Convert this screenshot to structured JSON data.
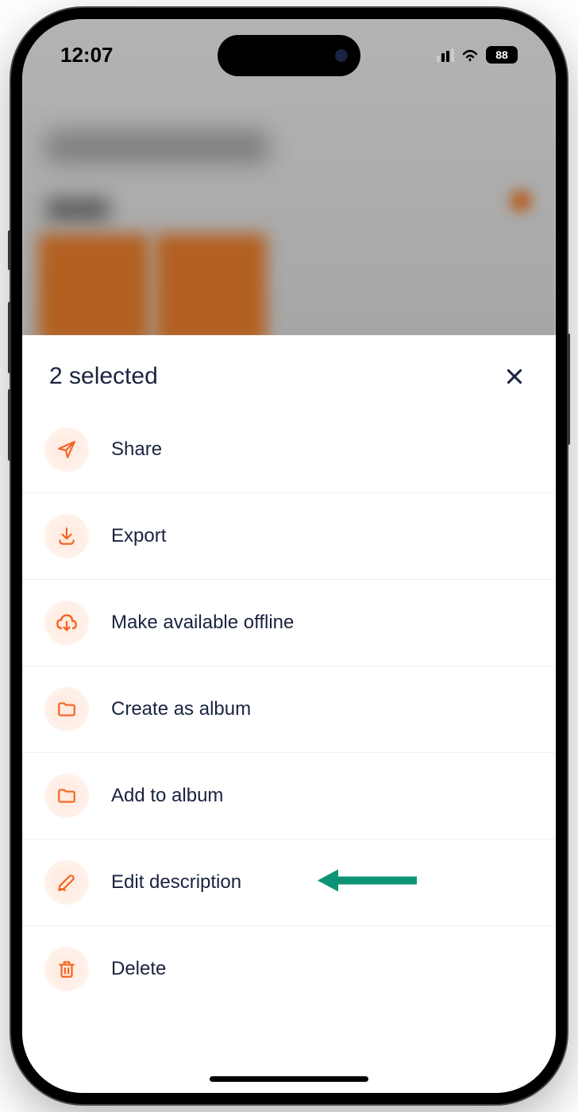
{
  "status": {
    "time": "12:07",
    "battery": "88"
  },
  "sheet": {
    "title": "2 selected"
  },
  "menu": {
    "share": "Share",
    "export": "Export",
    "offline": "Make available offline",
    "create_album": "Create as album",
    "add_album": "Add to album",
    "edit_desc": "Edit description",
    "delete": "Delete"
  }
}
